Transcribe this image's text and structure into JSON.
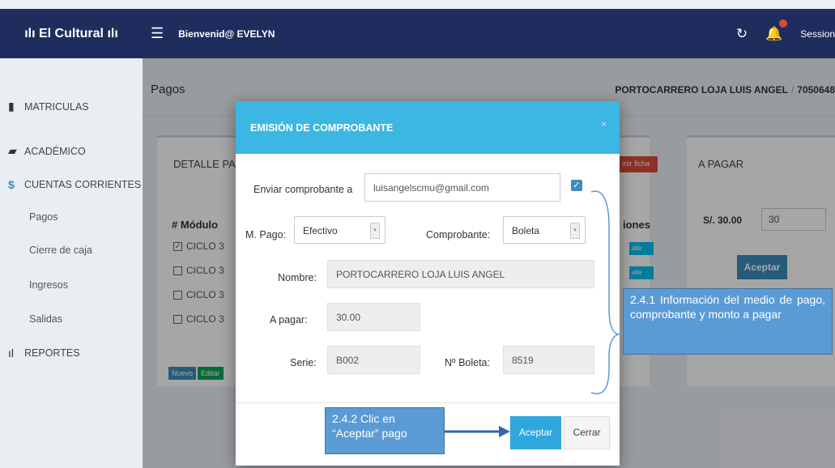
{
  "header": {
    "brand": "ılı El Cultural ılı",
    "menu_icon": "hamburger-icon",
    "welcome": "Bienvenid@ EVELYN",
    "refresh_icon": "refresh-icon",
    "notification_icon": "bell-icon",
    "session_label": "Session"
  },
  "sidebar": {
    "items": [
      {
        "label": "MATRICULAS",
        "icon": "book-icon",
        "glyph": "▮"
      },
      {
        "label": "ACADÉMICO",
        "icon": "folder-icon",
        "glyph": "▰"
      },
      {
        "label": "CUENTAS CORRIENTES",
        "icon": "dollar-icon",
        "glyph": "$"
      },
      {
        "label": "REPORTES",
        "icon": "bar-chart-icon",
        "glyph": "ıl"
      }
    ],
    "subitems": [
      "Pagos",
      "Cierre de caja",
      "Ingresos",
      "Salidas"
    ]
  },
  "page": {
    "title": "Pagos",
    "student_name": "PORTOCARRERO LOJA LUIS ANGEL",
    "student_sep": "/",
    "student_code": "7050648"
  },
  "detail_box": {
    "title": "DETALLE PA",
    "print_button": "mir ficha",
    "col_number": "# ",
    "col_module": "Módulo",
    "col_actions": "iones",
    "rows": [
      {
        "checked": true,
        "module": "CICLO 3"
      },
      {
        "checked": false,
        "module": "CICLO 3"
      },
      {
        "checked": false,
        "module": "CICLO 3"
      },
      {
        "checked": false,
        "module": "CICLO 3"
      }
    ],
    "row_action": "alle",
    "new_button": "Nuevo",
    "edit_button": "Editar"
  },
  "pay_box": {
    "title": "A PAGAR",
    "amount_label": "S/. 30.00",
    "amount_value": "30",
    "accept_button": "Aceptar"
  },
  "modal": {
    "title": "EMISIÓN DE COMPROBANTE",
    "close": "×",
    "send_to_label": "Enviar comprobante a",
    "send_to_value": "luisangelscmu@gmail.com",
    "send_checked": true,
    "payment_method_label": "M. Pago:",
    "payment_method_value": "Efectivo",
    "receipt_type_label": "Comprobante:",
    "receipt_type_value": "Boleta",
    "name_label": "Nombre:",
    "name_value": "PORTOCARRERO LOJA LUIS ANGEL",
    "amount_label": "A pagar:",
    "amount_value": "30.00",
    "series_label": "Serie:",
    "series_value": "B002",
    "receipt_no_label": "Nº Boleta:",
    "receipt_no_value": "8519",
    "accept_button": "Aceptar",
    "close_button": "Cerrar"
  },
  "annotations": {
    "a": "2.4.1 Información del medio de pago, comprobante y monto a pagar",
    "b": "2.4.2 Clic en “Aceptar” pago"
  },
  "colors": {
    "topbar": "#1f2d5e",
    "modal_header": "#3cb6e3",
    "callout": "#5b9bd5",
    "primary": "#3c8dbc"
  }
}
